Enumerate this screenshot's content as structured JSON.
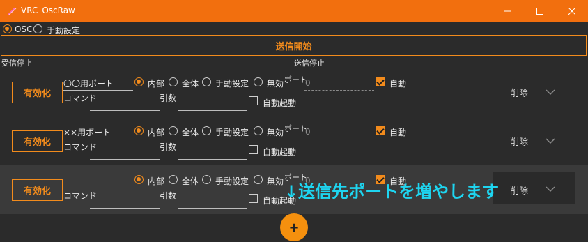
{
  "window": {
    "title": "VRC_OscRaw",
    "minimize_icon": "minimize-icon",
    "maximize_icon": "maximize-icon",
    "close_icon": "close-icon"
  },
  "mode": {
    "options": [
      "OSC",
      "手動設定"
    ],
    "selected": "OSC"
  },
  "start_button": "送信開始",
  "receive_status": "受信停止",
  "send_status": "送信停止",
  "rows": [
    {
      "enable_label": "有効化",
      "name_value": "〇〇用ポート",
      "command_label": "コマンド",
      "targets": [
        "内部",
        "全体",
        "手動設定",
        "無効"
      ],
      "selected_target": "内部",
      "port_label": "ポート",
      "port_value": "0",
      "args_label": "引数",
      "auto_label": "自動",
      "auto_checked": true,
      "autostart_label": "自動起動",
      "autostart_checked": false,
      "delete_label": "削除"
    },
    {
      "enable_label": "有効化",
      "name_value": "××用ポート",
      "command_label": "コマンド",
      "targets": [
        "内部",
        "全体",
        "手動設定",
        "無効"
      ],
      "selected_target": "内部",
      "port_label": "ポート",
      "port_value": "0",
      "args_label": "引数",
      "auto_label": "自動",
      "auto_checked": true,
      "autostart_label": "自動起動",
      "autostart_checked": false,
      "delete_label": "削除"
    },
    {
      "enable_label": "有効化",
      "name_value": "",
      "command_label": "コマンド",
      "targets": [
        "内部",
        "全体",
        "手動設定",
        "無効"
      ],
      "selected_target": "内部",
      "port_label": "ポート",
      "port_value": "0",
      "args_label": "引数",
      "auto_label": "自動",
      "auto_checked": true,
      "autostart_label": "自動起動",
      "autostart_checked": false,
      "delete_label": "削除"
    }
  ],
  "add_button": "+",
  "annotation": "↓送信先ポートを増やします",
  "colors": {
    "accent": "#f28b1c",
    "titlebar": "#f26f0e",
    "annotation": "#1ed5f0",
    "background": "#2b2b2b"
  }
}
